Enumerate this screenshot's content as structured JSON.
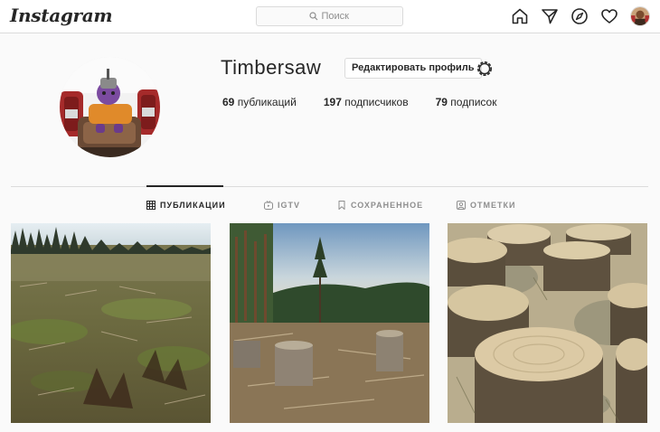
{
  "header": {
    "logo": "Instagram",
    "search_placeholder": "Поиск",
    "icons": [
      "search-icon",
      "home-icon",
      "direct-icon",
      "explore-icon",
      "activity-heart-icon",
      "profile-avatar"
    ]
  },
  "profile": {
    "username": "Timbersaw",
    "edit_button": "Редактировать профиль",
    "settings_icon": "gear-icon",
    "stats": [
      {
        "count": "69",
        "label": "публикаций"
      },
      {
        "count": "197",
        "label": "подписчиков"
      },
      {
        "count": "79",
        "label": "подписок"
      }
    ]
  },
  "tabs": [
    {
      "label": "ПУБЛИКАЦИИ",
      "icon": "grid-icon",
      "active": true
    },
    {
      "label": "IGTV",
      "icon": "igtv-icon",
      "active": false
    },
    {
      "label": "СОХРАНЕННОЕ",
      "icon": "bookmark-icon",
      "active": false
    },
    {
      "label": "ОТМЕТКИ",
      "icon": "tagged-icon",
      "active": false
    }
  ],
  "posts": [
    {
      "subject": "clear-cut forest field"
    },
    {
      "subject": "tree stumps with lone pine"
    },
    {
      "subject": "close-up cut tree stumps"
    }
  ],
  "colors": {
    "text": "#262626",
    "secondary_text": "#8e8e8e",
    "border": "#dbdbdb",
    "background": "#fafafa"
  }
}
